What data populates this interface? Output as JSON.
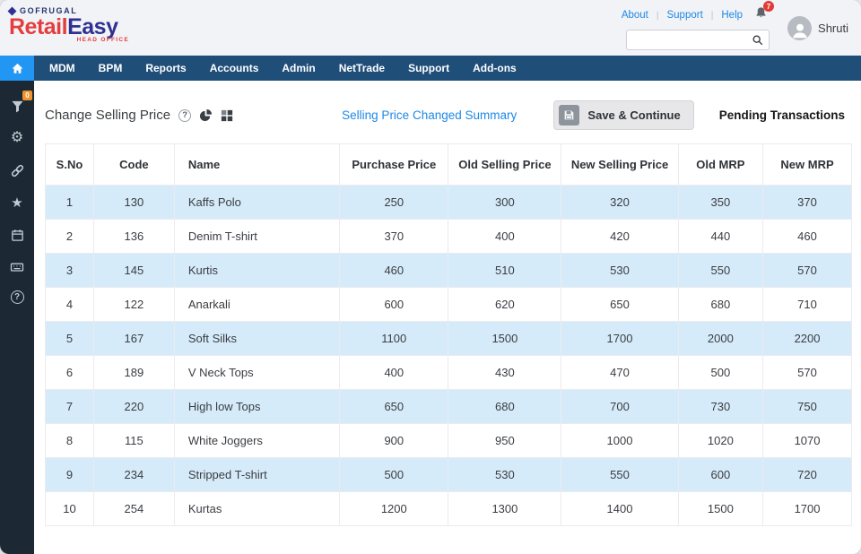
{
  "brand": {
    "company": "GOFRUGAL",
    "product_first": "Retail",
    "product_second": "Easy",
    "tagline": "HEAD OFFICE"
  },
  "topbar": {
    "links": [
      "About",
      "Support",
      "Help"
    ],
    "notification_count": "7",
    "search_value": "",
    "user_name": "Shruti"
  },
  "nav": {
    "items": [
      "MDM",
      "BPM",
      "Reports",
      "Accounts",
      "Admin",
      "NetTrade",
      "Support",
      "Add-ons"
    ]
  },
  "sidebar": {
    "filter_badge": "0",
    "icons": [
      "filter-icon",
      "gear-icon",
      "link-icon",
      "star-icon",
      "calendar-icon",
      "keyboard-icon",
      "help-icon"
    ]
  },
  "main": {
    "title": "Change Selling Price",
    "summary_link": "Selling Price Changed Summary",
    "save_button": "Save & Continue",
    "pending_label": "Pending Transactions"
  },
  "table": {
    "headers": [
      "S.No",
      "Code",
      "Name",
      "Purchase Price",
      "Old Selling Price",
      "New Selling Price",
      "Old MRP",
      "New MRP"
    ],
    "rows": [
      [
        "1",
        "130",
        "Kaffs Polo",
        "250",
        "300",
        "320",
        "350",
        "370"
      ],
      [
        "2",
        "136",
        "Denim T-shirt",
        "370",
        "400",
        "420",
        "440",
        "460"
      ],
      [
        "3",
        "145",
        "Kurtis",
        "460",
        "510",
        "530",
        "550",
        "570"
      ],
      [
        "4",
        "122",
        "Anarkali",
        "600",
        "620",
        "650",
        "680",
        "710"
      ],
      [
        "5",
        "167",
        "Soft Silks",
        "1100",
        "1500",
        "1700",
        "2000",
        "2200"
      ],
      [
        "6",
        "189",
        "V Neck Tops",
        "400",
        "430",
        "470",
        "500",
        "570"
      ],
      [
        "7",
        "220",
        "High low Tops",
        "650",
        "680",
        "700",
        "730",
        "750"
      ],
      [
        "8",
        "115",
        "White Joggers",
        "900",
        "950",
        "1000",
        "1020",
        "1070"
      ],
      [
        "9",
        "234",
        "Stripped T-shirt",
        "500",
        "530",
        "550",
        "600",
        "720"
      ],
      [
        "10",
        "254",
        "Kurtas",
        "1200",
        "1300",
        "1400",
        "1500",
        "1700"
      ]
    ]
  },
  "colors": {
    "accent_blue": "#1e88e5",
    "nav_blue": "#1f4e79",
    "home_tile_blue": "#2196f3",
    "row_alt_blue": "#d6ebf9",
    "badge_red": "#e53935",
    "badge_orange": "#f0932b",
    "brand_red": "#e43d3d",
    "brand_navy": "#2e3192",
    "sidebar_dark": "#1c2935"
  }
}
